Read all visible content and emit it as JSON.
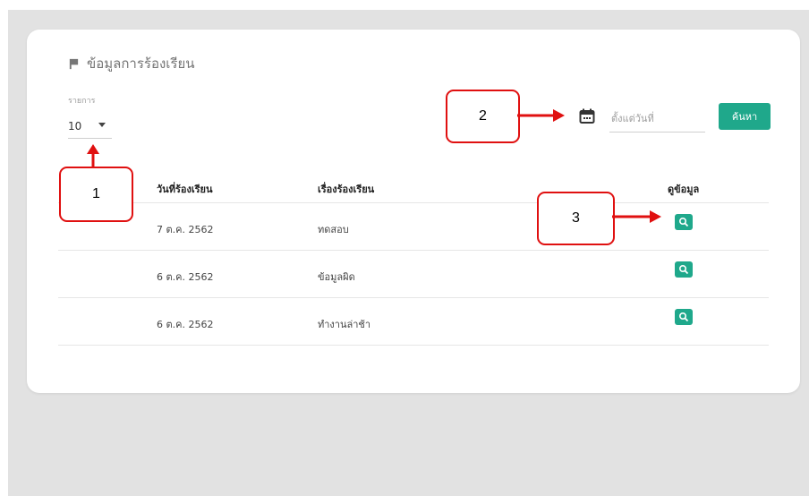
{
  "card": {
    "title": "ข้อมูลการร้องเรียน"
  },
  "rows_per_page": {
    "label": "รายการ",
    "value": "10"
  },
  "date_filter": {
    "placeholder": "ตั้งแต่วันที่"
  },
  "search_button": {
    "label": "ค้นหา"
  },
  "table": {
    "headers": {
      "date": "วันที่ร้องเรียน",
      "subject": "เรื่องร้องเรียน",
      "view": "ดูข้อมูล"
    },
    "rows": [
      {
        "date": "7 ต.ค. 2562",
        "subject": "ทดสอบ"
      },
      {
        "date": "6 ต.ค. 2562",
        "subject": "ข้อมูลผิด"
      },
      {
        "date": "6 ต.ค. 2562",
        "subject": "ทำงานล่าช้า"
      }
    ]
  },
  "annotations": {
    "a1": "1",
    "a2": "2",
    "a3": "3"
  },
  "colors": {
    "accent": "#1fa88b",
    "annotation": "#e01010",
    "background": "#e2e2e2"
  },
  "icons": {
    "title": "flag-icon",
    "date": "calendar-icon",
    "row_action": "search-icon",
    "rows_select": "caret-down-icon"
  }
}
